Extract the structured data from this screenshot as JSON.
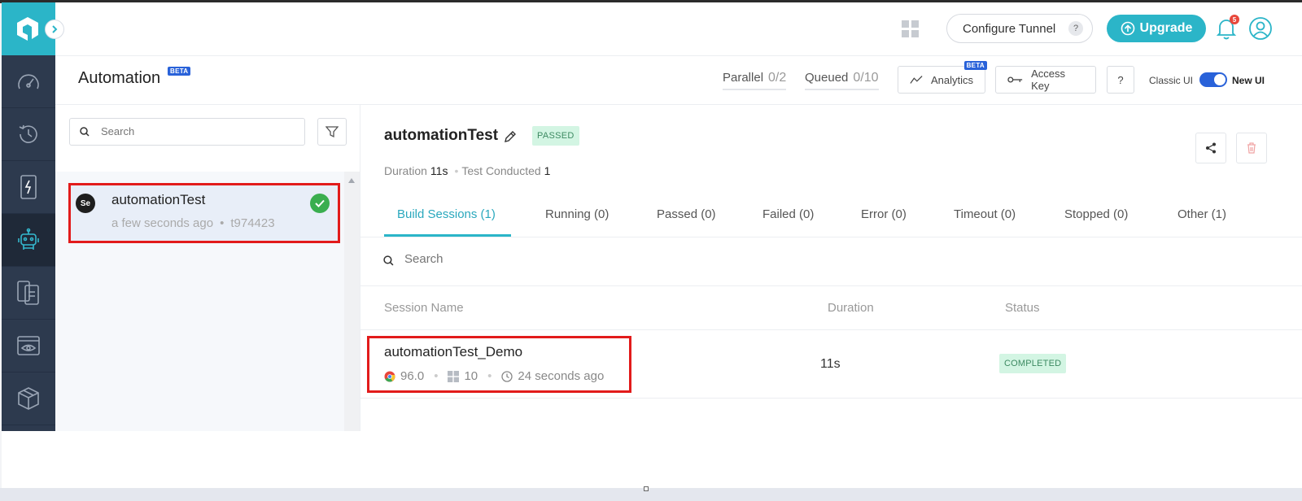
{
  "nav": {
    "items": [
      {
        "icon": "speedometer-icon"
      },
      {
        "icon": "history-clock-icon"
      },
      {
        "icon": "mobile-lightning-icon"
      },
      {
        "icon": "robot-icon",
        "active": true
      },
      {
        "icon": "device-clipboard-icon"
      },
      {
        "icon": "visual-eye-icon"
      },
      {
        "icon": "package-box-icon"
      }
    ]
  },
  "header": {
    "tunnel_label": "Configure Tunnel",
    "tunnel_help": "?",
    "upgrade_label": "Upgrade",
    "notification_count": "5"
  },
  "subheader": {
    "title": "Automation",
    "title_badge": "BETA",
    "parallel_label": "Parallel",
    "parallel_value": "0/2",
    "queued_label": "Queued",
    "queued_value": "0/10",
    "analytics_label": "Analytics",
    "analytics_badge": "BETA",
    "access_key_label": "Access Key",
    "help_label": "?",
    "classic_ui_label": "Classic UI",
    "new_ui_label": "New UI"
  },
  "builds": {
    "search_placeholder": "Search",
    "items": [
      {
        "badge": "Se",
        "name": "automationTest",
        "time": "a few seconds ago",
        "id": "t974423",
        "status": "passed"
      }
    ]
  },
  "detail": {
    "title": "automationTest",
    "status": "PASSED",
    "duration_label": "Duration",
    "duration_value": "11s",
    "conducted_label": "Test Conducted",
    "conducted_value": "1",
    "tabs": [
      {
        "label": "Build Sessions (1)",
        "active": true
      },
      {
        "label": "Running (0)"
      },
      {
        "label": "Passed (0)"
      },
      {
        "label": "Failed (0)"
      },
      {
        "label": "Error (0)"
      },
      {
        "label": "Timeout (0)"
      },
      {
        "label": "Stopped (0)"
      },
      {
        "label": "Other (1)"
      }
    ],
    "session_search_placeholder": "Search",
    "columns": [
      "Session Name",
      "Duration",
      "Status"
    ],
    "sessions": [
      {
        "name": "automationTest_Demo",
        "browser_version": "96.0",
        "os_version": "10",
        "time": "24 seconds ago",
        "duration": "11s",
        "status": "COMPLETED"
      }
    ]
  },
  "colors": {
    "accent": "#2bb5c8",
    "nav_bg": "#2d3a4e",
    "highlight": "#e21b1b",
    "toggle": "#2962d9",
    "success": "#3aae4f"
  }
}
